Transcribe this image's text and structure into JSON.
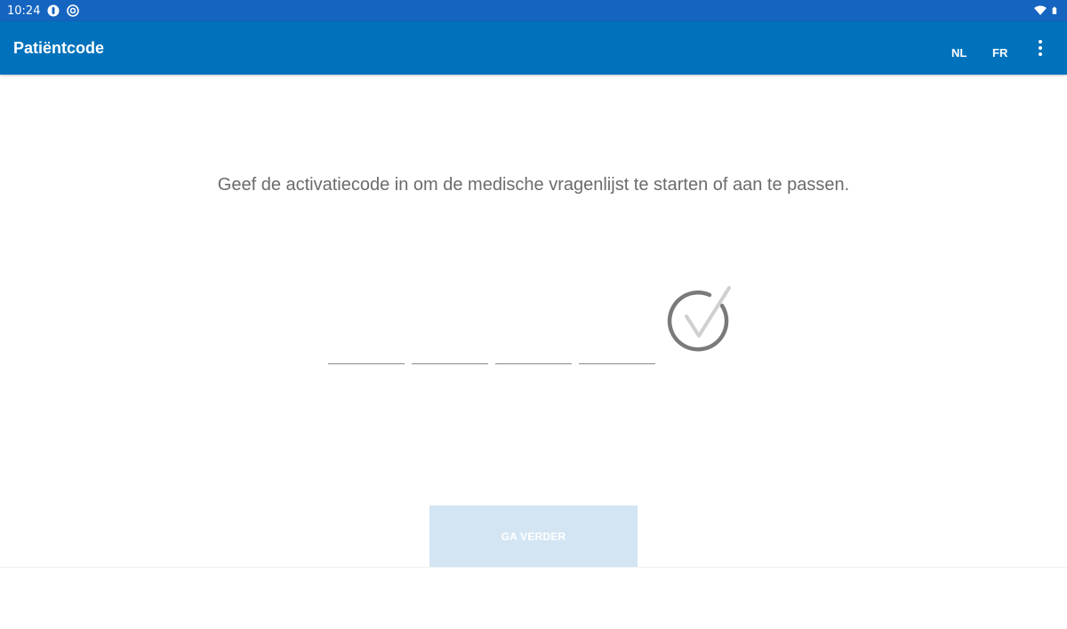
{
  "status_bar": {
    "time": "10:24",
    "icons": [
      "notification-icon",
      "at-sign-icon",
      "wifi-icon",
      "battery-icon"
    ],
    "color": "#1565c0"
  },
  "app_bar": {
    "title": "Patiëntcode",
    "lang_nl": "NL",
    "lang_fr": "FR",
    "overflow_icon": "more-vert-icon",
    "color": "#0072bc"
  },
  "main": {
    "instruction": "Geef de activatiecode in om de medische vragenlijst te starten of aan te passen.",
    "code_fields": [
      {
        "value": "",
        "placeholder": ""
      },
      {
        "value": "",
        "placeholder": ""
      },
      {
        "value": "",
        "placeholder": ""
      },
      {
        "value": "",
        "placeholder": ""
      }
    ],
    "check_icon": "check-circle-icon",
    "continue_label": "GA VERDER",
    "continue_color": "#d3e5f3"
  }
}
